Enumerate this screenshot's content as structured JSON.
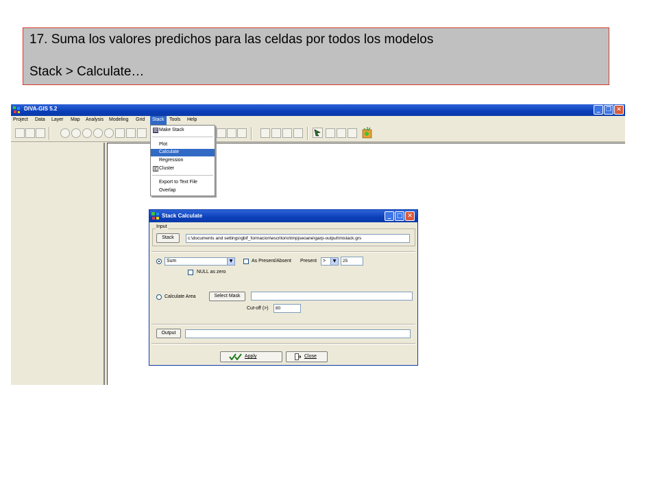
{
  "instruction": {
    "line1": "17. Suma los valores predichos para las celdas por todos los modelos",
    "line2": "Stack > Calculate…"
  },
  "window": {
    "title": "DIVA-GIS 5.2",
    "controls": {
      "minimize": "_",
      "restore": "❐",
      "close": "✕"
    }
  },
  "menubar": {
    "items": [
      "Project",
      "Data",
      "Layer",
      "Map",
      "Analysis",
      "Modeling",
      "Grid",
      "Stack",
      "Tools",
      "Help"
    ],
    "active": "Stack"
  },
  "stack_menu": {
    "items": [
      {
        "label": "Make Stack",
        "icon": "stack-icon"
      },
      {
        "label": "Plot"
      },
      {
        "label": "Calculate",
        "selected": true
      },
      {
        "label": "Regression"
      },
      {
        "label": "Cluster",
        "icon": "cluster-icon"
      },
      {
        "label": "Export to Text File"
      },
      {
        "label": "Overlap"
      }
    ]
  },
  "dialog": {
    "title": "Stack Calculate",
    "input_group_label": "Input",
    "stack_button": "Stack",
    "stack_path": "c:\\documents and settings\\gbif_formacion\\escritorio\\tmpjseoane\\garp-output\\mistack.grs",
    "function_value": "Sum",
    "as_present_absent_label": "As Present/Absent",
    "present_label": "Present",
    "present_operator": ">",
    "present_value": "25",
    "null_as_zero_label": "NULL as zero",
    "calculate_area_label": "Calculate Area",
    "select_mask_button": "Select Mask",
    "mask_path": "",
    "cutoff_label": "Cut-off (>)",
    "cutoff_value": "80",
    "output_button": "Output",
    "output_path": "",
    "apply_button": "Apply",
    "close_button": "Close"
  }
}
